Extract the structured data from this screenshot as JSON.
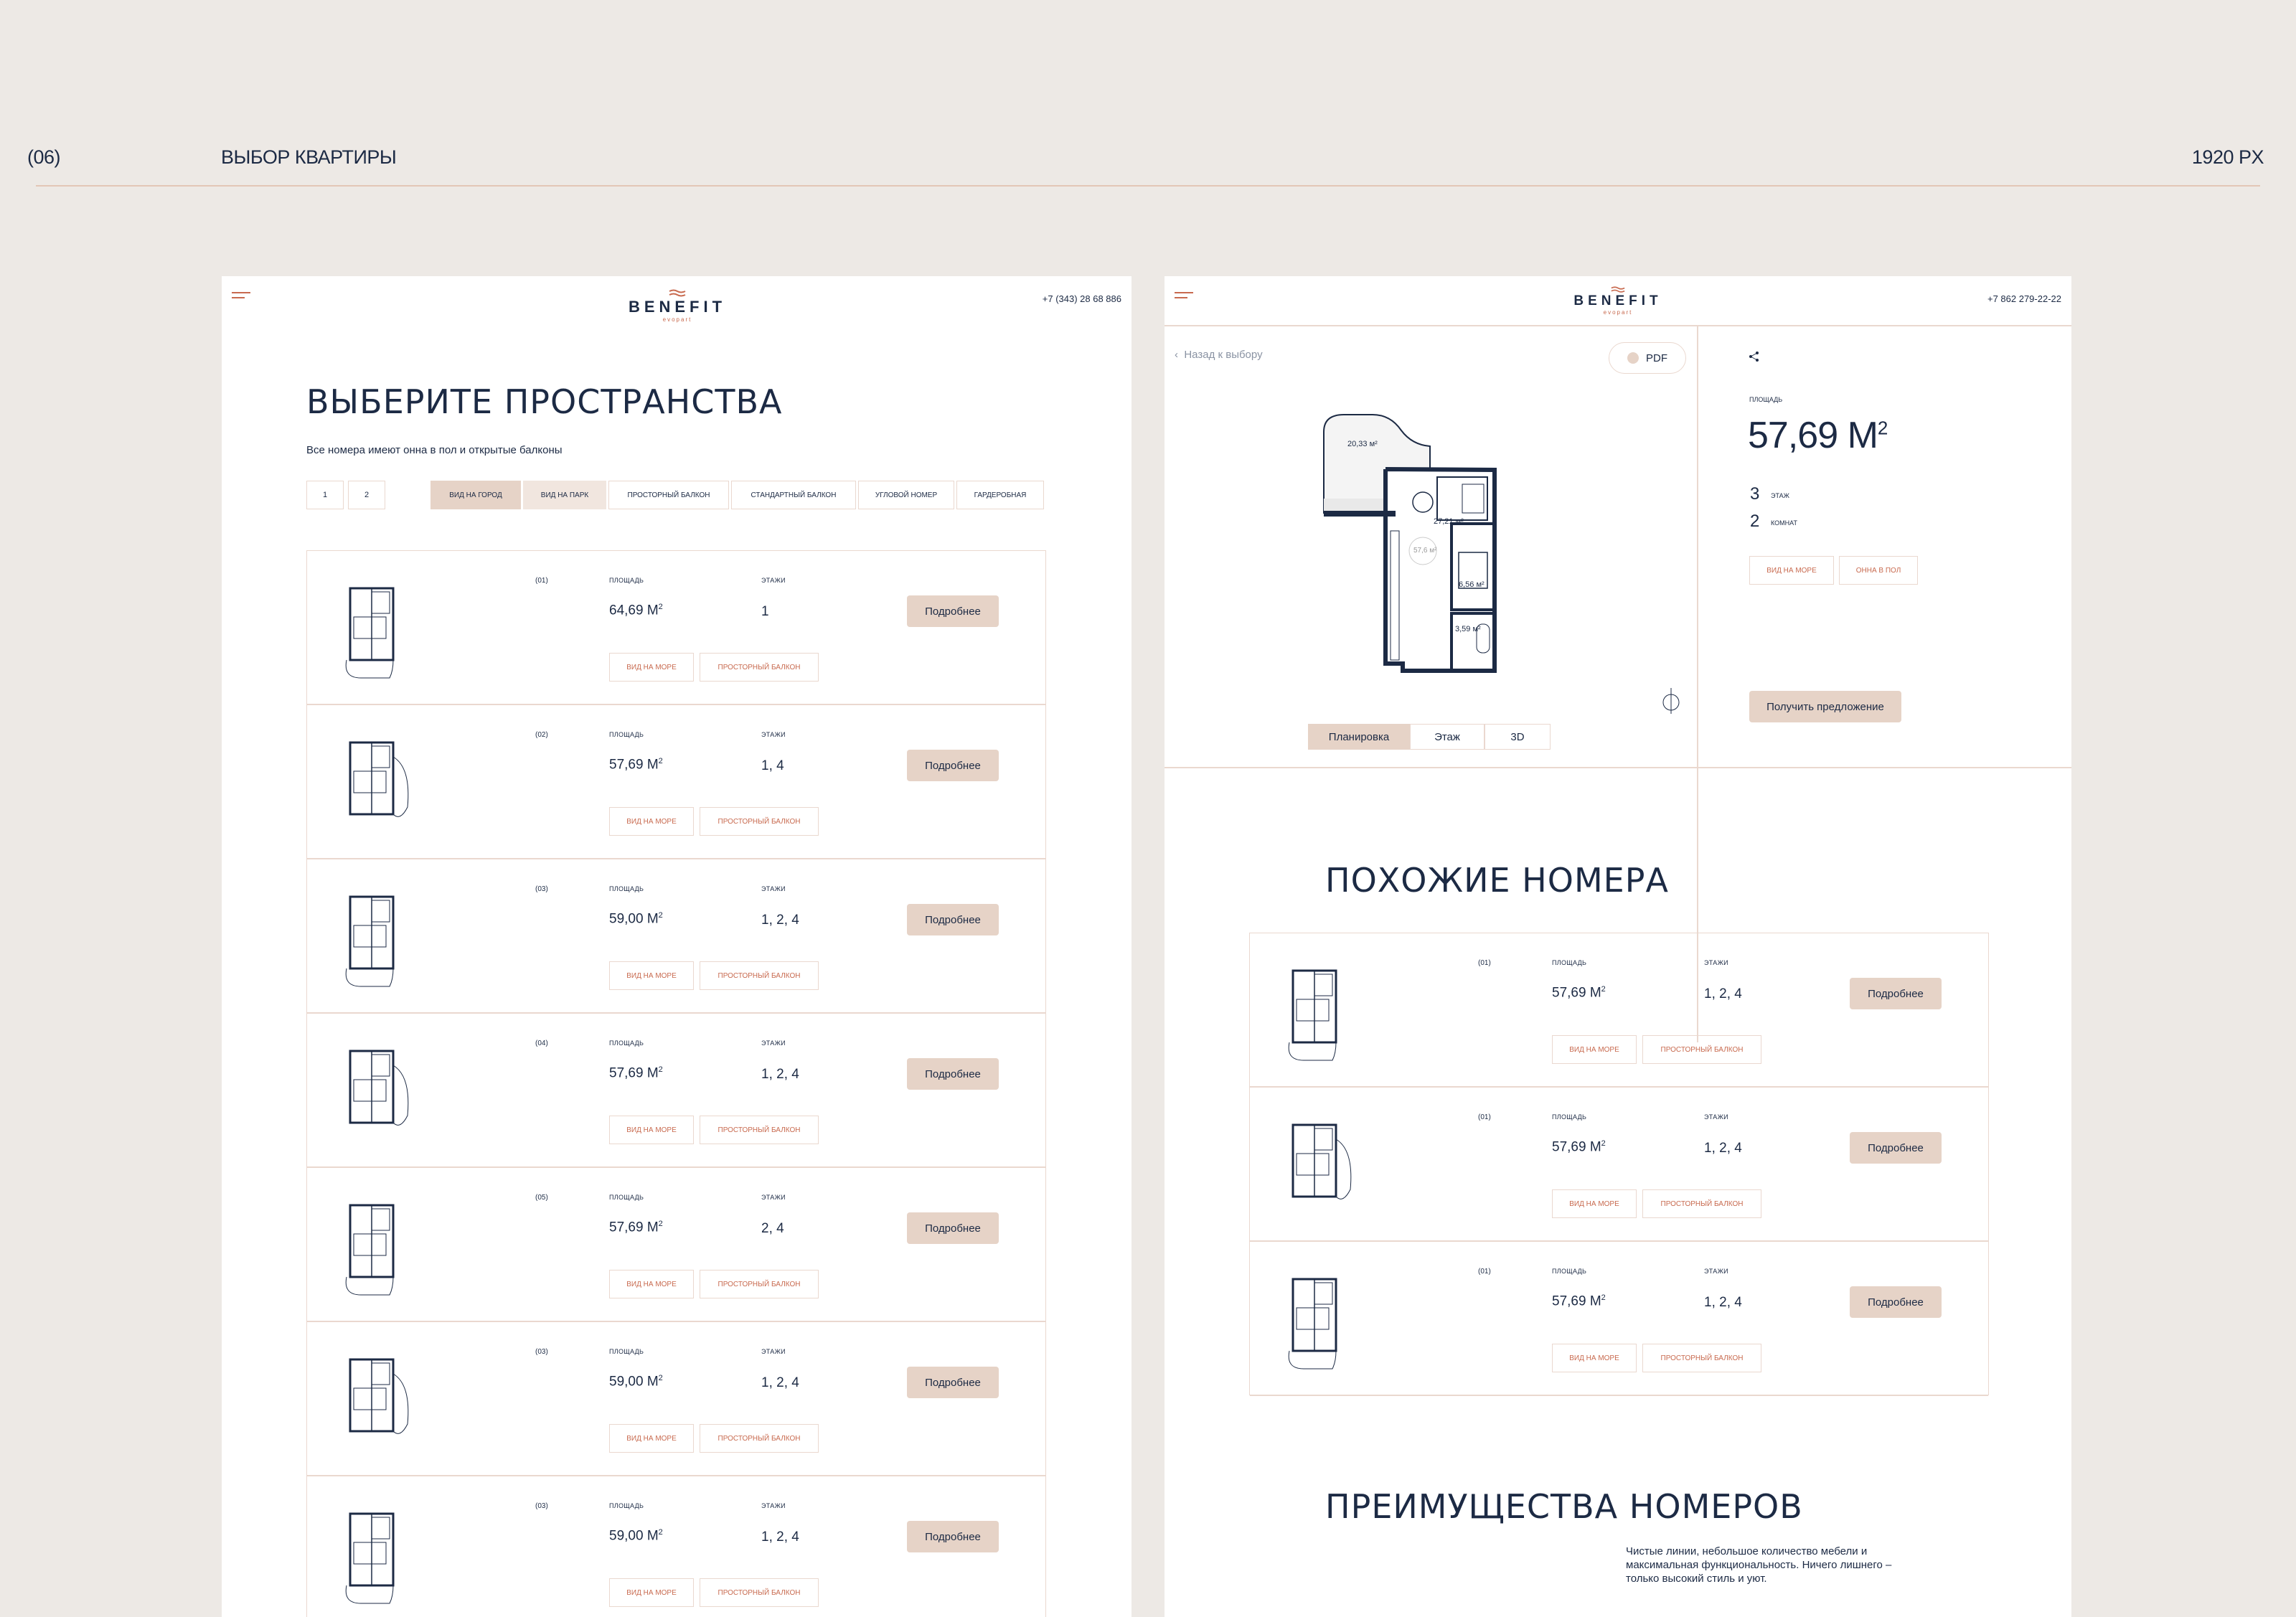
{
  "header": {
    "section_number": "(06)",
    "section_title": "ВЫБОР КВАРТИРЫ",
    "resolution": "1920 PX"
  },
  "colors": {
    "background": "#ede9e5",
    "text": "#1c2a44",
    "accent": "#c86a4f",
    "button": "#e6d3c7",
    "border": "#ead8cf"
  },
  "left": {
    "brand": "BENEFIT",
    "brand_sub": "evopart",
    "phone": "+7 (343) 28 68 886",
    "title": "ВЫБЕРИТЕ ПРОСТРАНСТВА",
    "subtitle": "Все номера имеют онна в пол и открытые балконы",
    "pages": [
      "1",
      "2"
    ],
    "filters": [
      "ВИД НА ГОРОД",
      "ВИД НА ПАРК",
      "ПРОСТОРНЫЙ БАЛКОН",
      "СТАНДАРТНЫЙ БАЛКОН",
      "УГЛОВОЙ НОМЕР",
      "ГАРДЕРОБНАЯ"
    ],
    "area_label": "ПЛОЩАДЬ",
    "floors_label": "ЭТАЖИ",
    "more_label": "Подробнее",
    "area_unit": "М",
    "rows": [
      {
        "index": "(01)",
        "area": "64,69",
        "floors": "1",
        "tags": [
          "ВИД НА МОРЕ",
          "ПРОСТОРНЫЙ БАЛКОН"
        ]
      },
      {
        "index": "(02)",
        "area": "57,69",
        "floors": "1, 4",
        "tags": [
          "ВИД НА МОРЕ",
          "ПРОСТОРНЫЙ БАЛКОН"
        ]
      },
      {
        "index": "(03)",
        "area": "59,00",
        "floors": "1, 2, 4",
        "tags": [
          "ВИД НА МОРЕ",
          "ПРОСТОРНЫЙ БАЛКОН"
        ]
      },
      {
        "index": "(04)",
        "area": "57,69",
        "floors": "1, 2, 4",
        "tags": [
          "ВИД НА МОРЕ",
          "ПРОСТОРНЫЙ БАЛКОН"
        ]
      },
      {
        "index": "(05)",
        "area": "57,69",
        "floors": "2, 4",
        "tags": [
          "ВИД НА МОРЕ",
          "ПРОСТОРНЫЙ БАЛКОН"
        ]
      },
      {
        "index": "(03)",
        "area": "59,00",
        "floors": "1, 2, 4",
        "tags": [
          "ВИД НА МОРЕ",
          "ПРОСТОРНЫЙ БАЛКОН"
        ]
      },
      {
        "index": "(03)",
        "area": "59,00",
        "floors": "1, 2, 4",
        "tags": [
          "ВИД НА МОРЕ",
          "ПРОСТОРНЫЙ БАЛКОН"
        ]
      }
    ]
  },
  "right": {
    "brand": "BENEFIT",
    "brand_sub": "evopart",
    "phone": "+7 862 279-22-22",
    "back_label": "Назад к выбору",
    "pdf_label": "PDF",
    "plan_labels": [
      "20,33 м²",
      "27,21 м²",
      "57,6 м²",
      "6,56 м²",
      "3,59 м²"
    ],
    "views": [
      "Планировка",
      "Этаж",
      "3D"
    ],
    "area_label": "ПЛОЩАДЬ",
    "area_value": "57,69 М",
    "floor_count": "3",
    "floor_label": "ЭТАЖ",
    "rooms_count": "2",
    "rooms_label": "КОМНАТ",
    "tags": [
      "ВИД НА МОРЕ",
      "ОННА В ПОЛ"
    ],
    "offer_label": "Получить предложение",
    "similar_title": "ПОХОЖИЕ НОМЕРА",
    "similar_rows": [
      {
        "index": "(01)",
        "area": "57,69",
        "floors": "1, 2, 4",
        "tags": [
          "ВИД НА МОРЕ",
          "ПРОСТОРНЫЙ БАЛКОН"
        ]
      },
      {
        "index": "(01)",
        "area": "57,69",
        "floors": "1, 2, 4",
        "tags": [
          "ВИД НА МОРЕ",
          "ПРОСТОРНЫЙ БАЛКОН"
        ]
      },
      {
        "index": "(01)",
        "area": "57,69",
        "floors": "1, 2, 4",
        "tags": [
          "ВИД НА МОРЕ",
          "ПРОСТОРНЫЙ БАЛКОН"
        ]
      }
    ],
    "advantages_title": "ПРЕИМУЩЕСТВА НОМЕРОВ",
    "advantages_text": "Чистые линии, небольшое количество мебели и максимальная функциональность. Ничего лишнего – только высокий стиль и уют."
  }
}
